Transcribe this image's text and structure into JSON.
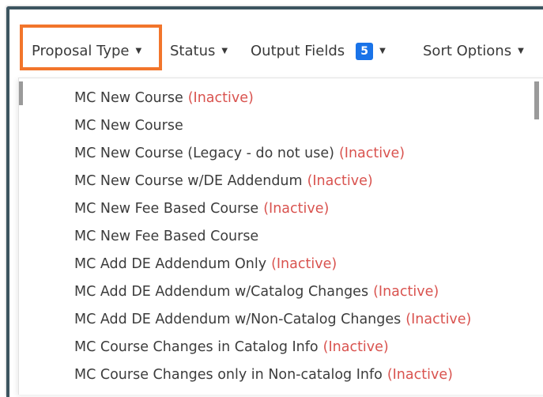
{
  "toolbar": {
    "proposal_type": "Proposal Type",
    "status": "Status",
    "output_fields": "Output Fields",
    "output_fields_count": "5",
    "sort_options": "Sort Options"
  },
  "menu": {
    "inactive_label": "(Inactive)",
    "items": [
      {
        "label": "MC New Course",
        "inactive": true
      },
      {
        "label": "MC New Course",
        "inactive": false
      },
      {
        "label": "MC New Course (Legacy - do not use)",
        "inactive": true
      },
      {
        "label": "MC New Course w/DE Addendum",
        "inactive": true
      },
      {
        "label": "MC New Fee Based Course",
        "inactive": true
      },
      {
        "label": "MC New Fee Based Course",
        "inactive": false
      },
      {
        "label": "MC Add DE Addendum Only",
        "inactive": true
      },
      {
        "label": "MC Add DE Addendum w/Catalog Changes",
        "inactive": true
      },
      {
        "label": "MC Add DE Addendum w/Non-Catalog Changes",
        "inactive": true
      },
      {
        "label": "MC Course Changes in Catalog Info",
        "inactive": true
      },
      {
        "label": "MC Course Changes only in Non-catalog Info",
        "inactive": true
      }
    ]
  },
  "colors": {
    "highlight": "#f2752b",
    "badge": "#1a73e8",
    "inactive": "#d9534f",
    "frame": "#3c5560"
  }
}
